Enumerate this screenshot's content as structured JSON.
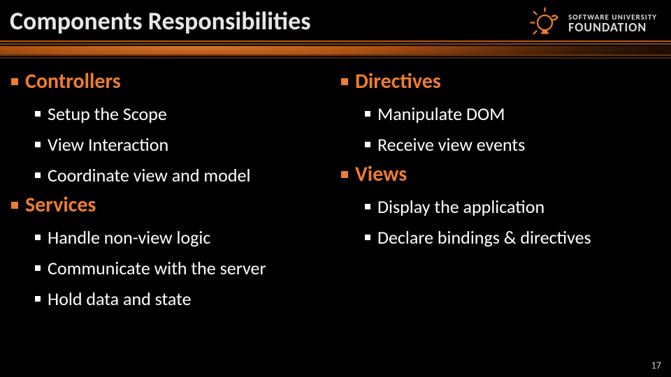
{
  "title": "Components Responsibilities",
  "logo": {
    "line1": "SOFTWARE UNIVERSITY",
    "line2": "FOUNDATION"
  },
  "left": [
    {
      "label": "Controllers",
      "items": [
        "Setup the Scope",
        "View Interaction",
        "Coordinate view and model"
      ]
    },
    {
      "label": "Services",
      "items": [
        "Handle non-view logic",
        "Communicate with the server",
        "Hold data and state"
      ]
    }
  ],
  "right": [
    {
      "label": "Directives",
      "items": [
        "Manipulate DOM",
        "Receive view events"
      ]
    },
    {
      "label": "Views",
      "items": [
        "Display the application",
        "Declare bindings & directives"
      ]
    }
  ],
  "page_number": "17"
}
